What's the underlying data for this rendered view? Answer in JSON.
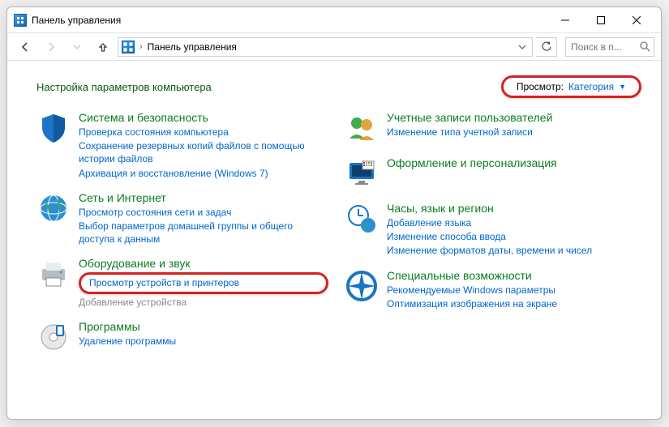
{
  "window": {
    "title": "Панель управления"
  },
  "addressbar": {
    "location": "Панель управления"
  },
  "search": {
    "placeholder": "Поиск в п..."
  },
  "header": {
    "heading": "Настройка параметров компьютера",
    "view_label": "Просмотр:",
    "view_value": "Категория"
  },
  "left": [
    {
      "title": "Система и безопасность",
      "links": [
        "Проверка состояния компьютера",
        "Сохранение резервных копий файлов с помощью истории файлов",
        "Архивация и восстановление (Windows 7)"
      ]
    },
    {
      "title": "Сеть и Интернет",
      "links": [
        "Просмотр состояния сети и задач",
        "Выбор параметров домашней группы и общего доступа к данным"
      ]
    },
    {
      "title": "Оборудование и звук",
      "highlight_link": "Просмотр устройств и принтеров",
      "muted_link": "Добавление устройства"
    },
    {
      "title": "Программы",
      "links": [
        "Удаление программы"
      ]
    }
  ],
  "right": [
    {
      "title": "Учетные записи пользователей",
      "links": [
        "Изменение типа учетной записи"
      ]
    },
    {
      "title": "Оформление и персонализация",
      "links": []
    },
    {
      "title": "Часы, язык и регион",
      "links": [
        "Добавление языка",
        "Изменение способа ввода",
        "Изменение форматов даты, времени и чисел"
      ]
    },
    {
      "title": "Специальные возможности",
      "links": [
        "Рекомендуемые Windows параметры",
        "Оптимизация изображения на экране"
      ]
    }
  ],
  "colors": {
    "link": "#0066cc",
    "category": "#0a7d1f",
    "highlight_border": "#d62222"
  }
}
